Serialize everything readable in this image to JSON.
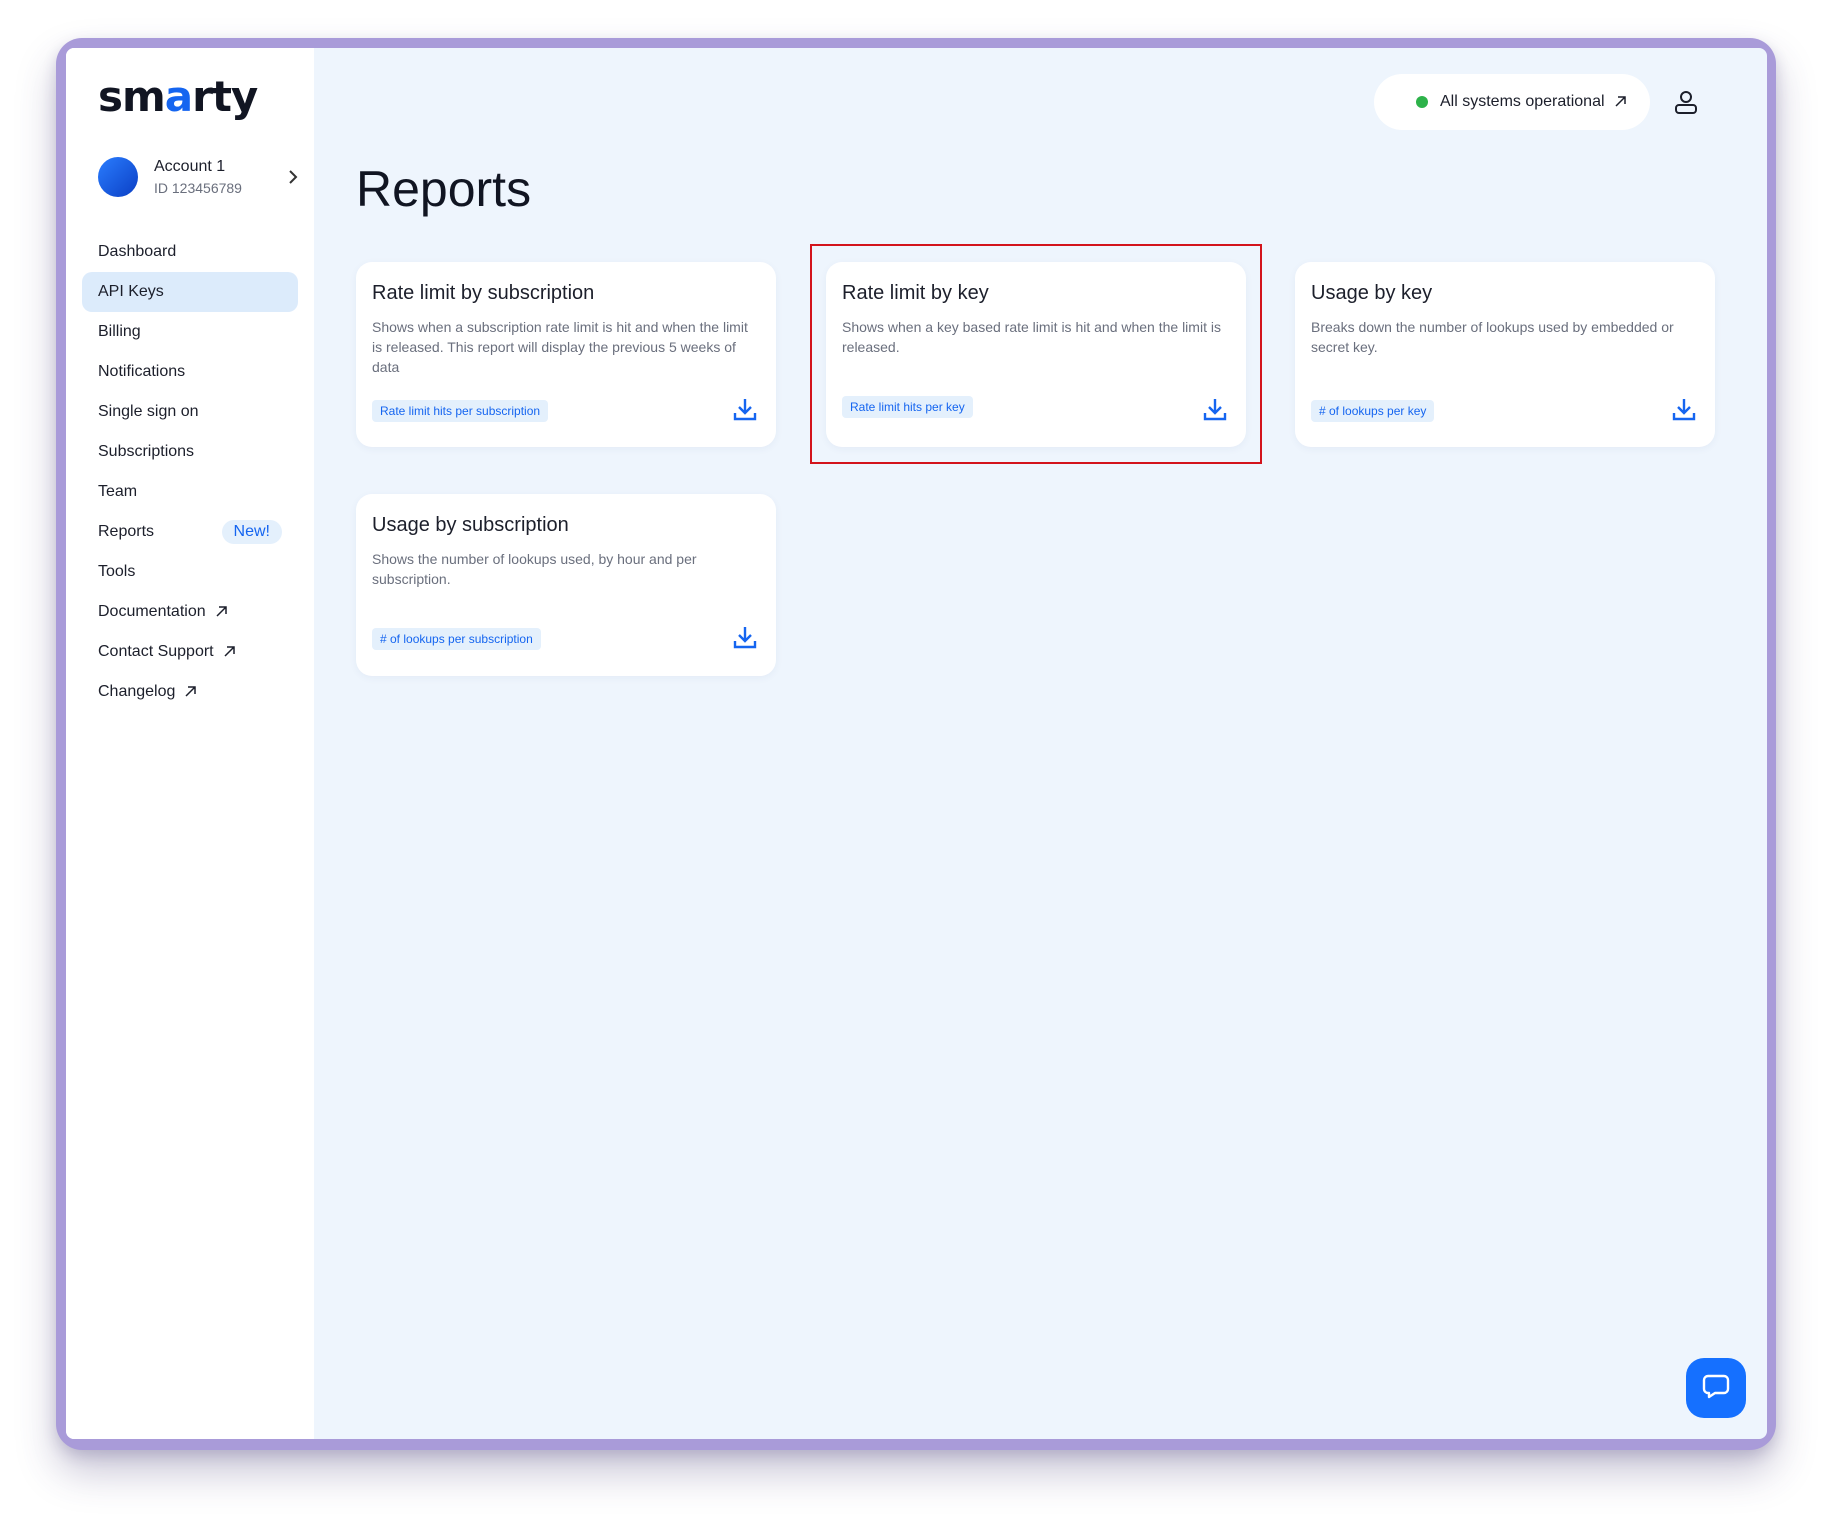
{
  "logo": {
    "pre": "sm",
    "accent": "a",
    "post": "rty"
  },
  "account": {
    "name": "Account 1",
    "id": "ID 123456789"
  },
  "nav": [
    {
      "label": "Dashboard"
    },
    {
      "label": "API Keys",
      "active": true
    },
    {
      "label": "Billing"
    },
    {
      "label": "Notifications"
    },
    {
      "label": "Single sign on"
    },
    {
      "label": "Subscriptions"
    },
    {
      "label": "Team"
    },
    {
      "label": "Reports",
      "badge": "New!"
    },
    {
      "label": "Tools"
    },
    {
      "label": "Documentation",
      "external": true
    },
    {
      "label": "Contact Support",
      "external": true
    },
    {
      "label": "Changelog",
      "external": true
    }
  ],
  "status": {
    "label": "All systems operational",
    "color": "#2db24a"
  },
  "page": {
    "title": "Reports"
  },
  "cards": [
    {
      "title": "Rate limit by subscription",
      "description": "Shows when a subscription rate limit is hit and when the limit is released. This report will display the previous 5 weeks of data",
      "tag": "Rate limit hits per subscription"
    },
    {
      "title": "Rate limit by key",
      "description": "Shows when a key based rate limit is hit and when the limit is released.",
      "tag": "Rate limit hits per key"
    },
    {
      "title": "Usage by key",
      "description": "Breaks down the number of lookups used by embedded or secret key.",
      "tag": "# of lookups per key"
    },
    {
      "title": "Usage by subscription",
      "description": "Shows the number of lookups used, by hour and per subscription.",
      "tag": "# of lookups per subscription"
    }
  ],
  "colors": {
    "accent": "#1565f0",
    "highlight": "#d3141c",
    "background": "#eef5fd",
    "frame": "#a99bd9"
  }
}
